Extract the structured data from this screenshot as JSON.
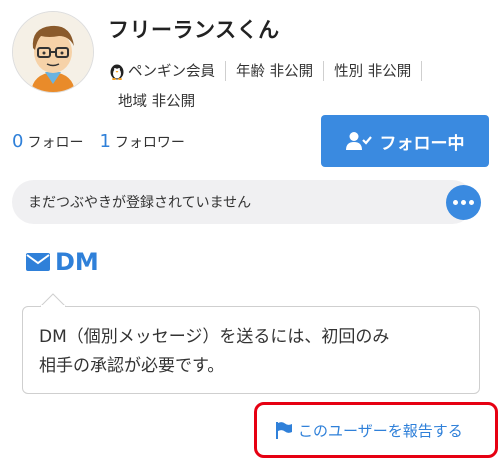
{
  "profile": {
    "username": "フリーランスくん",
    "member_type": "ペンギン会員",
    "age": "年齢 非公開",
    "gender": "性別 非公開",
    "region": "地域 非公開"
  },
  "stats": {
    "following_count": "0",
    "following_label": "フォロー",
    "followers_count": "1",
    "followers_label": "フォロワー"
  },
  "follow_button": {
    "label": "フォロー中"
  },
  "tweets": {
    "empty_text": "まだつぶやきが登録されていません"
  },
  "dm": {
    "label": "DM",
    "tooltip_line1": "DM（個別メッセージ）を送るには、初回のみ",
    "tooltip_line2": "相手の承認が必要です。"
  },
  "report": {
    "label": "このユーザーを報告する"
  },
  "colors": {
    "accent": "#3a8ae0",
    "link": "#2f80d9",
    "highlight": "#e60012"
  },
  "icons": [
    "penguin-icon",
    "user-check-icon",
    "more-icon",
    "envelope-icon",
    "flag-icon"
  ]
}
